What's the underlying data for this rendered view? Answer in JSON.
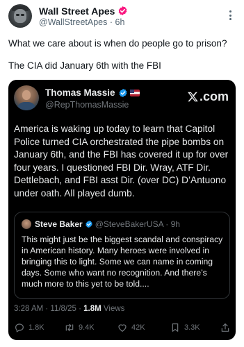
{
  "post": {
    "author_name": "Wall Street Apes",
    "handle": "@WallStreetApes",
    "separator": "·",
    "time": "6h",
    "text_line_1": "What we care about is when do people go to prison?",
    "text_line_2": "The CIA did January 6th with the FBI"
  },
  "embed": {
    "author_name": "Thomas Massie",
    "handle": "@RepThomasMassie",
    "brand": ".com",
    "body": "America is waking up today to learn that Capitol Police turned CIA orchestrated the pipe bombs on January 6th, and the FBI has covered it up for over four years. I questioned FBI Dir. Wray, ATF Dir. Dettlebach, and FBI asst Dir. (over DC) D’Antuono under oath. All played dumb.",
    "quote": {
      "author_name": "Steve Baker",
      "handle_time": "@SteveBakerUSA · 9h",
      "body": "This might just be the biggest scandal and conspiracy in American history. Many heroes were involved in bringing this to light. Some we can name in coming days. Some who want no recognition. And there’s much more to this yet to be told...."
    },
    "meta_time": "3:28 AM · 11/8/25 · ",
    "views_count": "1.8M",
    "views_label": " Views",
    "stats": {
      "replies": "1.8K",
      "reposts": "9.4K",
      "likes": "42K",
      "bookmarks": "3.3K"
    }
  },
  "icons": {
    "verified_badge": "verified-badge-icon",
    "more": "more-icon",
    "x_logo": "x-logo-icon",
    "flag": "flag-icon",
    "reply": "reply-icon",
    "repost": "repost-icon",
    "like": "heart-icon",
    "bookmark": "bookmark-icon",
    "share": "share-icon"
  },
  "colors": {
    "verified_pink": "#f91880",
    "verified_blue": "#1d9bf0",
    "card_background": "#000000",
    "muted_text": "#71767b"
  }
}
